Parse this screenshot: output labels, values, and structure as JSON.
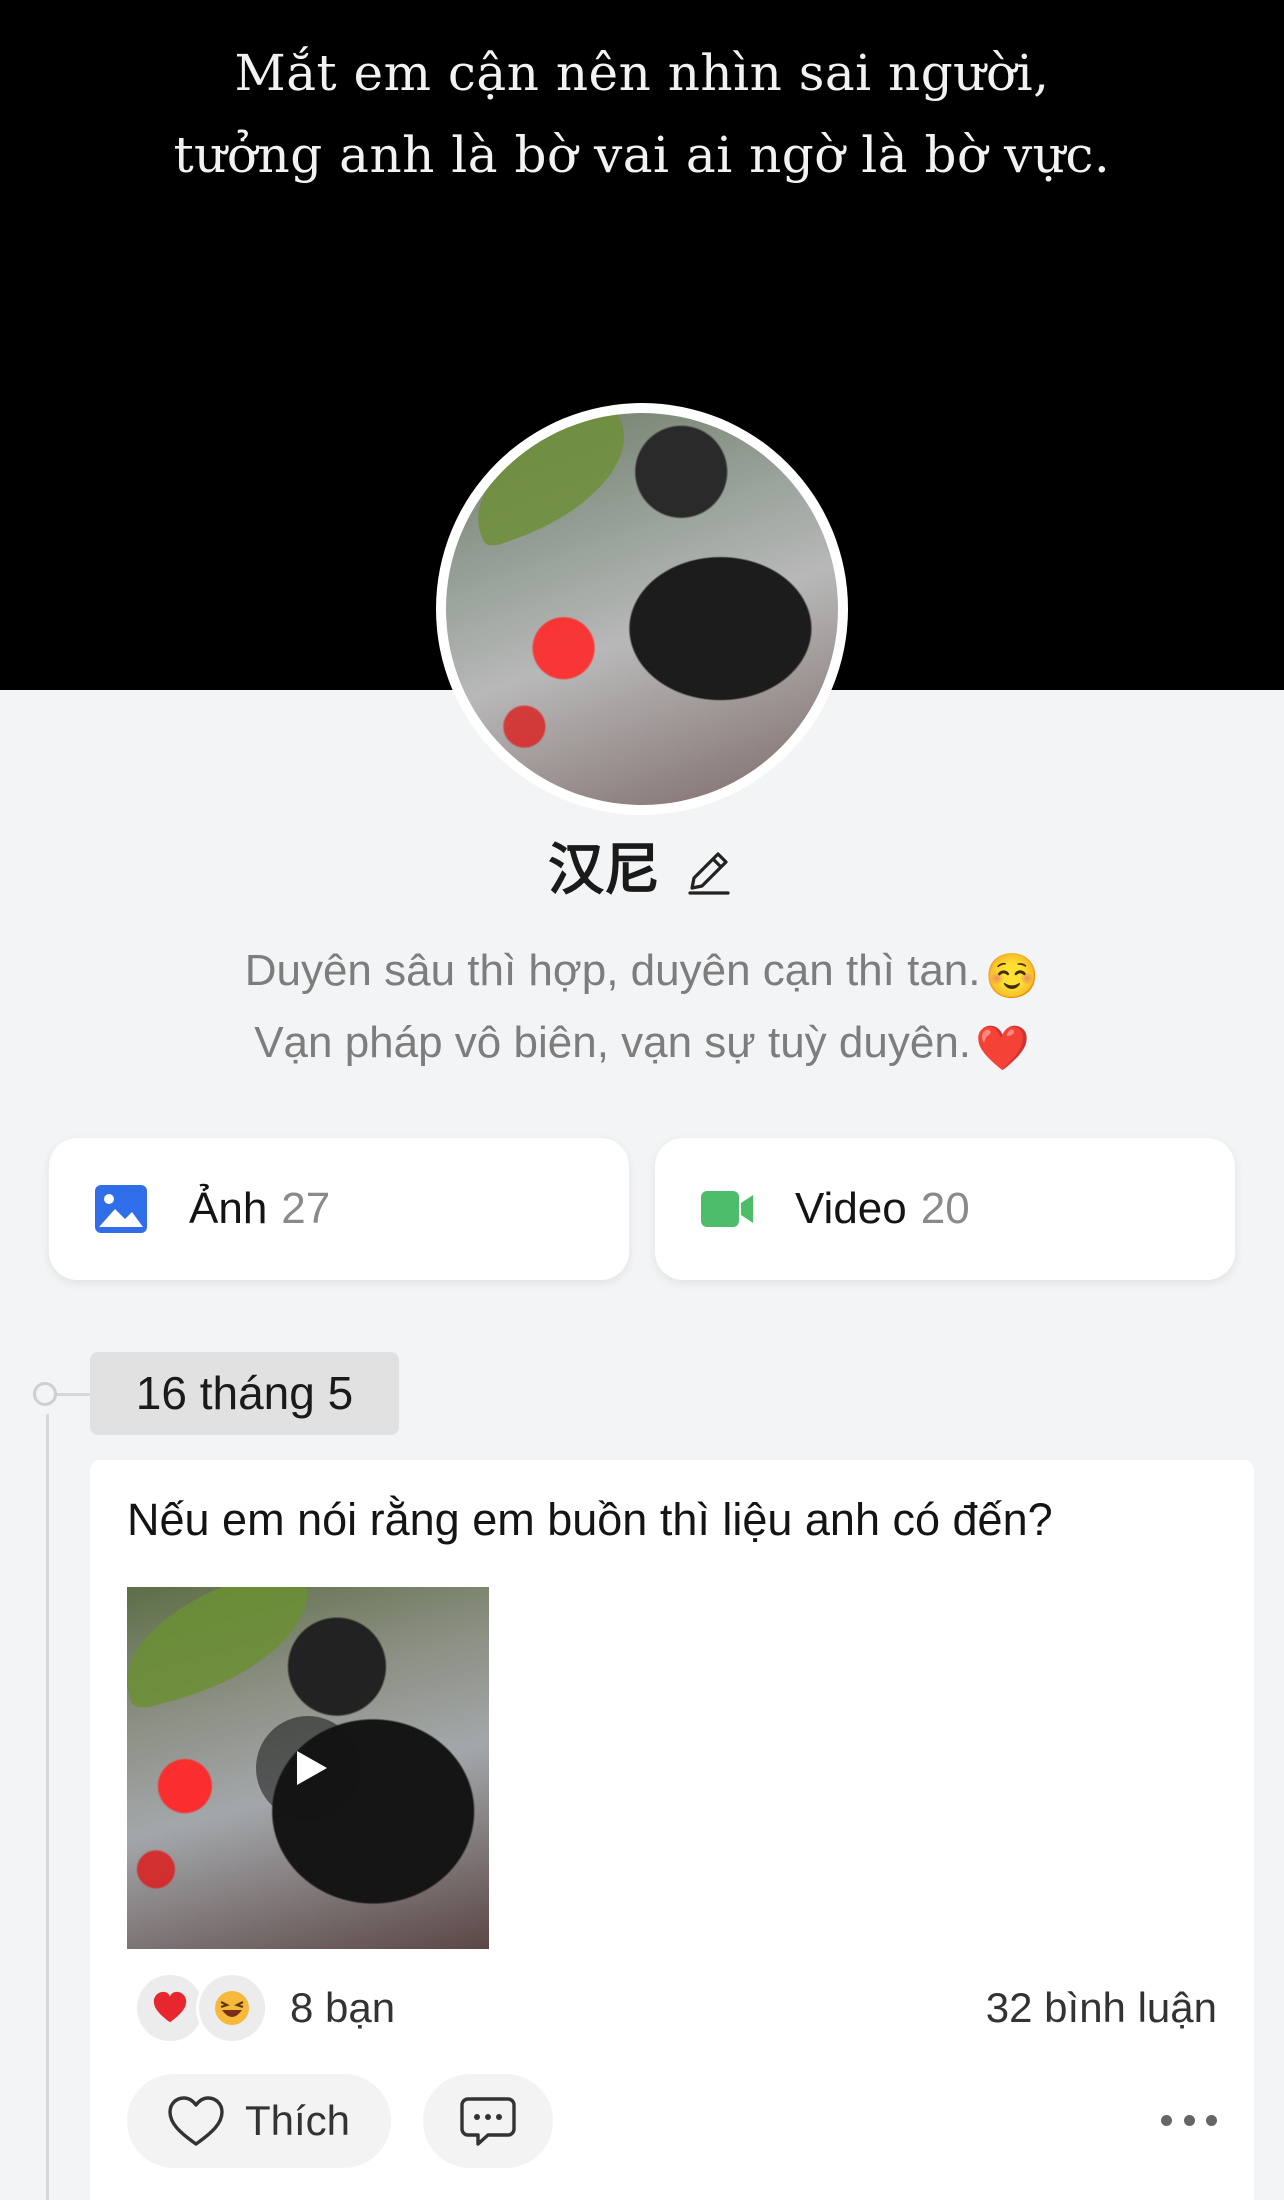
{
  "cover": {
    "line1": "Mắt em cận nên nhìn sai người,",
    "line2": "tưởng anh là bờ vai ai ngờ là bờ vực."
  },
  "profile": {
    "name": "汉尼",
    "bio_line1": "Duyên sâu thì hợp, duyên cạn thì tan.",
    "bio_line1_emoji": "☺️",
    "bio_line2": "Vạn pháp vô biên, vạn sự tuỳ duyên.",
    "bio_line2_emoji": "❤️"
  },
  "media": {
    "photos_label": "Ảnh",
    "photos_count": "27",
    "videos_label": "Video",
    "videos_count": "20",
    "photo_icon_color": "#2f6ee8",
    "video_icon_color": "#4ebd6a"
  },
  "timeline": {
    "date": "16 tháng 5"
  },
  "post": {
    "text": "Nếu em nói rằng em buồn thì liệu anh có đến?",
    "reaction_emojis": [
      "❤️",
      "😂"
    ],
    "reactions_count": "8 bạn",
    "comments_count": "32 bình luận",
    "like_label": "Thích"
  }
}
